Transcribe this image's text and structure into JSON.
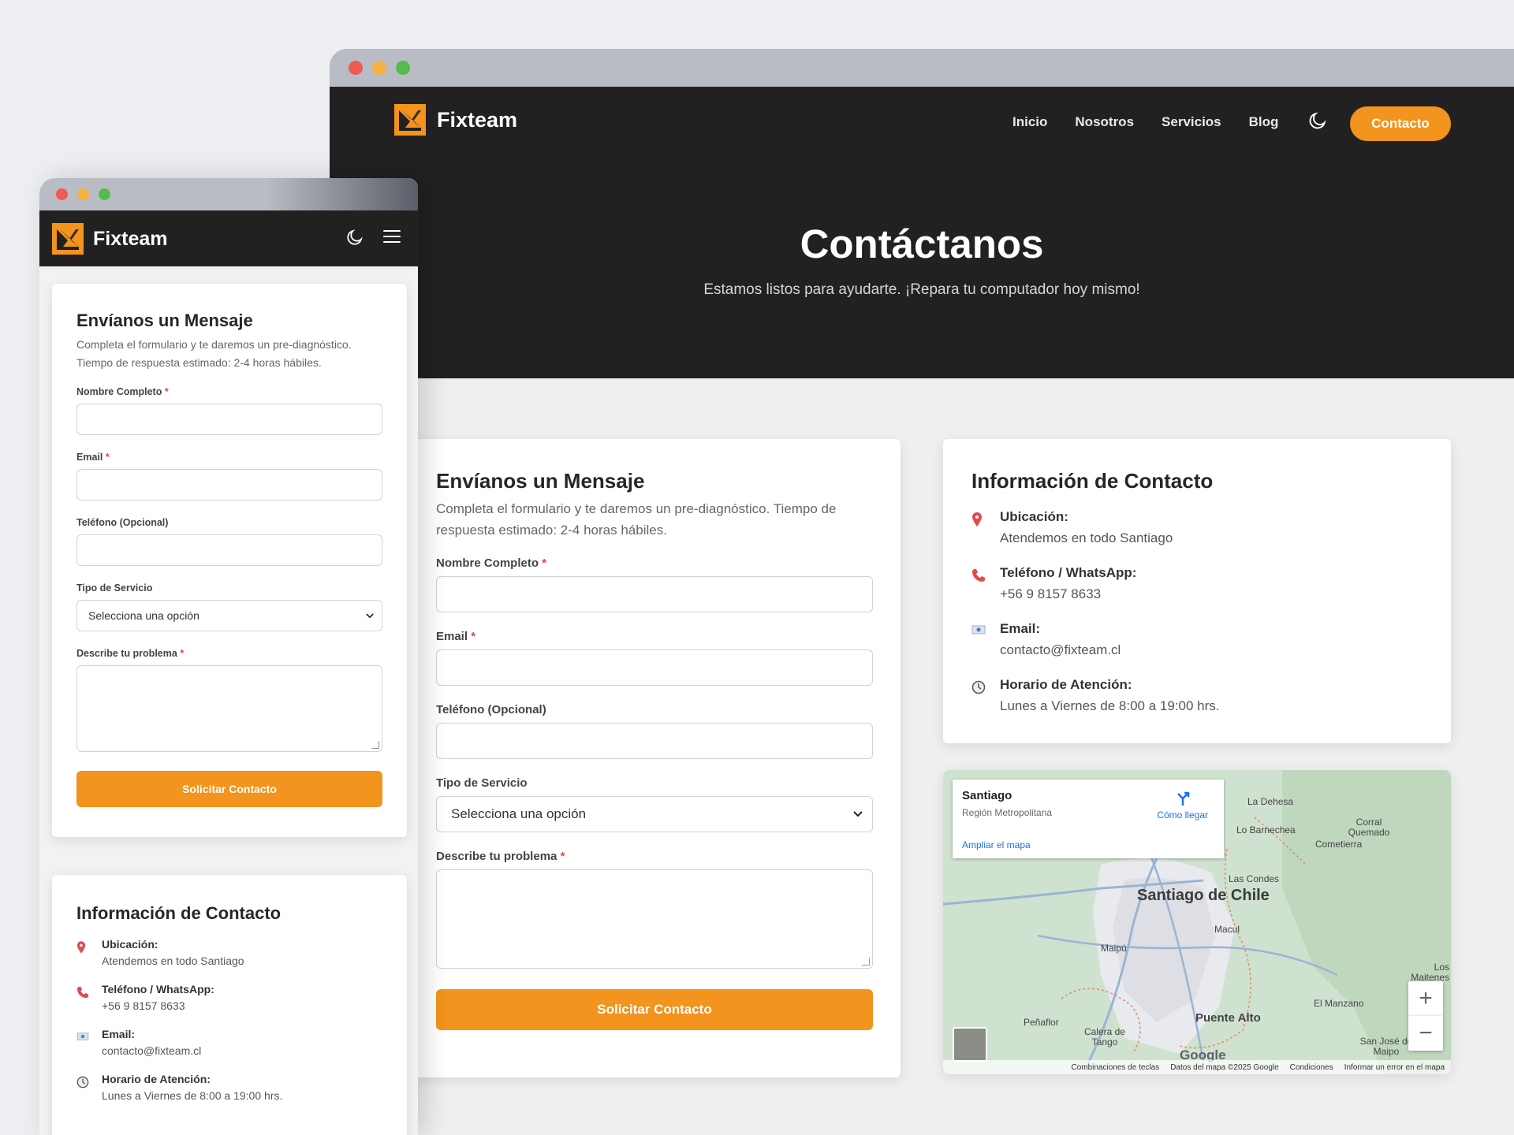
{
  "brand": {
    "name": "Fixteam",
    "accent": "#f2941d",
    "dark": "#232022"
  },
  "nav": {
    "items": [
      "Inicio",
      "Nosotros",
      "Servicios",
      "Blog"
    ],
    "cta": "Contacto",
    "theme_icon": "moon-icon",
    "menu_icon": "hamburger-icon"
  },
  "hero": {
    "title": "Contáctanos",
    "subtitle": "Estamos listos para ayudarte. ¡Repara tu computador hoy mismo!"
  },
  "form": {
    "title": "Envíanos un Mensaje",
    "subtitle": "Completa el formulario y te daremos un pre-diagnóstico. Tiempo de respuesta estimado: 2-4 horas hábiles.",
    "fields": {
      "name": "Nombre Completo",
      "email": "Email",
      "phone": "Teléfono (Opcional)",
      "service": "Tipo de Servicio",
      "problem": "Describe tu problema"
    },
    "required_mark": "*",
    "service_selected": "Selecciona una opción",
    "submit": "Solicitar Contacto"
  },
  "info": {
    "title": "Información de Contacto",
    "items": [
      {
        "icon": "location-pin-icon",
        "title": "Ubicación:",
        "value": "Atendemos en todo Santiago"
      },
      {
        "icon": "phone-icon",
        "title": "Teléfono / WhatsApp:",
        "value": "+56 9 8157 8633"
      },
      {
        "icon": "email-icon",
        "title": "Email:",
        "value": "contacto@fixteam.cl"
      },
      {
        "icon": "clock-icon",
        "title": "Horario de Atención:",
        "value": "Lunes a Viernes de 8:00 a 19:00 hrs."
      }
    ]
  },
  "map": {
    "place": "Santiago",
    "region": "Región Metropolitana",
    "directions": "Cómo llegar",
    "expand": "Ampliar el mapa",
    "city_label": "Santiago de Chile",
    "towns": [
      "La Dehesa",
      "Lo Barnechea",
      "Corral Quemado",
      "Cometierra",
      "Las Condes",
      "Macul",
      "Maipú",
      "Peñaflor",
      "Calera de Tango",
      "Puente Alto",
      "El Manzano",
      "Los Maitenes",
      "San José de Maipo"
    ],
    "google": "Google",
    "footer": [
      "Combinaciones de teclas",
      "Datos del mapa ©2025 Google",
      "Condiciones",
      "Informar un error en el mapa"
    ],
    "zoom_in": "+",
    "zoom_out": "−"
  }
}
